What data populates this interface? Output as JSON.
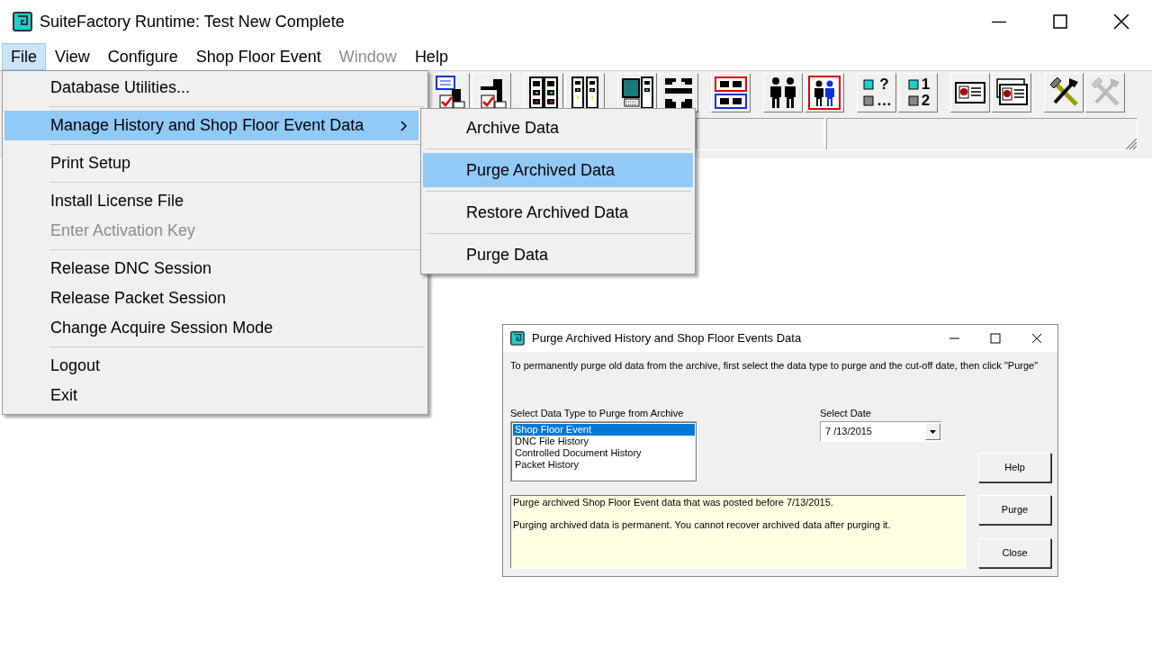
{
  "window": {
    "title": "SuiteFactory Runtime: Test New Complete"
  },
  "menu_bar": [
    {
      "label": "File",
      "selected": true,
      "disabled": false
    },
    {
      "label": "View",
      "selected": false,
      "disabled": false
    },
    {
      "label": "Configure",
      "selected": false,
      "disabled": false
    },
    {
      "label": "Shop Floor Event",
      "selected": false,
      "disabled": false
    },
    {
      "label": "Window",
      "selected": false,
      "disabled": true
    },
    {
      "label": "Help",
      "selected": false,
      "disabled": false
    }
  ],
  "toolbar": {
    "groups": [
      [
        {
          "kind": "monitor-check",
          "disabled": false
        },
        {
          "kind": "machine-check",
          "disabled": false
        }
      ],
      [
        {
          "kind": "cabinets-three",
          "disabled": false
        },
        {
          "kind": "cabinets-two",
          "disabled": false
        }
      ],
      [
        {
          "kind": "computer-cabinet",
          "disabled": false
        },
        {
          "kind": "connectors",
          "disabled": false
        }
      ],
      [
        {
          "kind": "connectors-boxed",
          "disabled": false
        }
      ],
      [
        {
          "kind": "people",
          "disabled": false
        },
        {
          "kind": "people-boxed",
          "disabled": false
        }
      ],
      [
        {
          "kind": "squares",
          "marks": [
            "?",
            "…"
          ],
          "disabled": false
        },
        {
          "kind": "squares",
          "marks": [
            "1",
            "2"
          ],
          "disabled": false
        }
      ],
      [
        {
          "kind": "id-card",
          "disabled": false
        },
        {
          "kind": "id-cards",
          "disabled": false
        }
      ],
      [
        {
          "kind": "tools",
          "disabled": false
        },
        {
          "kind": "tools",
          "disabled": true
        }
      ]
    ]
  },
  "file_menu": [
    {
      "kind": "item",
      "label": "Database Utilities...",
      "selected": false,
      "disabled": false,
      "submenu": false
    },
    {
      "kind": "separator"
    },
    {
      "kind": "item",
      "label": "Manage History and Shop Floor Event Data",
      "selected": true,
      "disabled": false,
      "submenu": true
    },
    {
      "kind": "separator"
    },
    {
      "kind": "item",
      "label": "Print Setup",
      "selected": false,
      "disabled": false,
      "submenu": false
    },
    {
      "kind": "separator"
    },
    {
      "kind": "item",
      "label": "Install License File",
      "selected": false,
      "disabled": false,
      "submenu": false
    },
    {
      "kind": "item",
      "label": "Enter Activation Key",
      "selected": false,
      "disabled": true,
      "submenu": false
    },
    {
      "kind": "separator"
    },
    {
      "kind": "item",
      "label": "Release DNC Session",
      "selected": false,
      "disabled": false,
      "submenu": false
    },
    {
      "kind": "item",
      "label": "Release Packet Session",
      "selected": false,
      "disabled": false,
      "submenu": false
    },
    {
      "kind": "item",
      "label": "Change Acquire Session Mode",
      "selected": false,
      "disabled": false,
      "submenu": false
    },
    {
      "kind": "separator"
    },
    {
      "kind": "item",
      "label": "Logout",
      "selected": false,
      "disabled": false,
      "submenu": false
    },
    {
      "kind": "item",
      "label": "Exit",
      "selected": false,
      "disabled": false,
      "submenu": false
    }
  ],
  "submenu": [
    {
      "kind": "item",
      "label": "Archive Data",
      "selected": false
    },
    {
      "kind": "separator"
    },
    {
      "kind": "item",
      "label": "Purge Archived Data",
      "selected": true
    },
    {
      "kind": "separator"
    },
    {
      "kind": "item",
      "label": "Restore Archived Data",
      "selected": false
    },
    {
      "kind": "separator"
    },
    {
      "kind": "item",
      "label": "Purge Data",
      "selected": false
    }
  ],
  "dialog": {
    "title": "Purge Archived History and Shop Floor Events Data",
    "instructions": "To permanently purge old data from the archive, first select the data type to purge and the cut-off date, then click \"Purge\"",
    "data_type_label": "Select Data Type to Purge from Archive",
    "data_types": [
      {
        "label": "Shop Floor Event",
        "selected": true
      },
      {
        "label": "DNC File History",
        "selected": false
      },
      {
        "label": "Controlled Document History",
        "selected": false
      },
      {
        "label": "Packet History",
        "selected": false
      }
    ],
    "date_label": "Select Date",
    "date_value": "7 /13/2015",
    "info": [
      "Purge archived Shop Floor Event data that was posted before 7/13/2015.",
      "Purging archived data is permanent. You cannot recover archived data after purging it."
    ],
    "buttons": {
      "help": "Help",
      "purge": "Purge",
      "close": "Close"
    }
  }
}
